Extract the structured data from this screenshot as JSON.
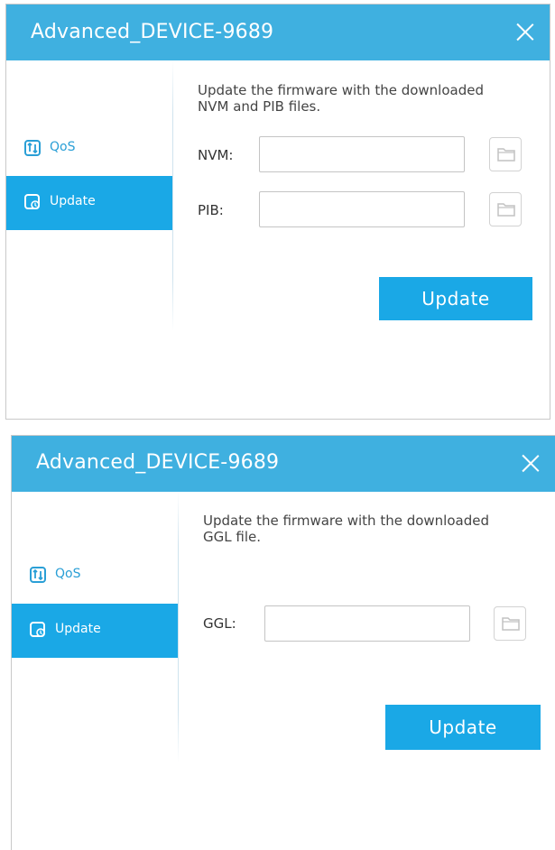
{
  "colors": {
    "titlebar": "#3fb0e0",
    "accent": "#1aa8e6",
    "link": "#2a9fd6"
  },
  "dialogs": [
    {
      "title": "Advanced_DEVICE-9689",
      "nav": [
        {
          "label": "QoS",
          "icon": "qos-icon"
        },
        {
          "label": "Update",
          "icon": "update-icon",
          "active": true
        }
      ],
      "description": "Update the firmware with the downloaded NVM and PIB files.",
      "fields": [
        {
          "label": "NVM:",
          "value": ""
        },
        {
          "label": "PIB:",
          "value": ""
        }
      ],
      "button": "Update"
    },
    {
      "title": "Advanced_DEVICE-9689",
      "nav": [
        {
          "label": "QoS",
          "icon": "qos-icon"
        },
        {
          "label": "Update",
          "icon": "update-icon",
          "active": true
        }
      ],
      "description": "Update the firmware with the downloaded GGL file.",
      "fields": [
        {
          "label": "GGL:",
          "value": ""
        }
      ],
      "button": "Update"
    }
  ]
}
